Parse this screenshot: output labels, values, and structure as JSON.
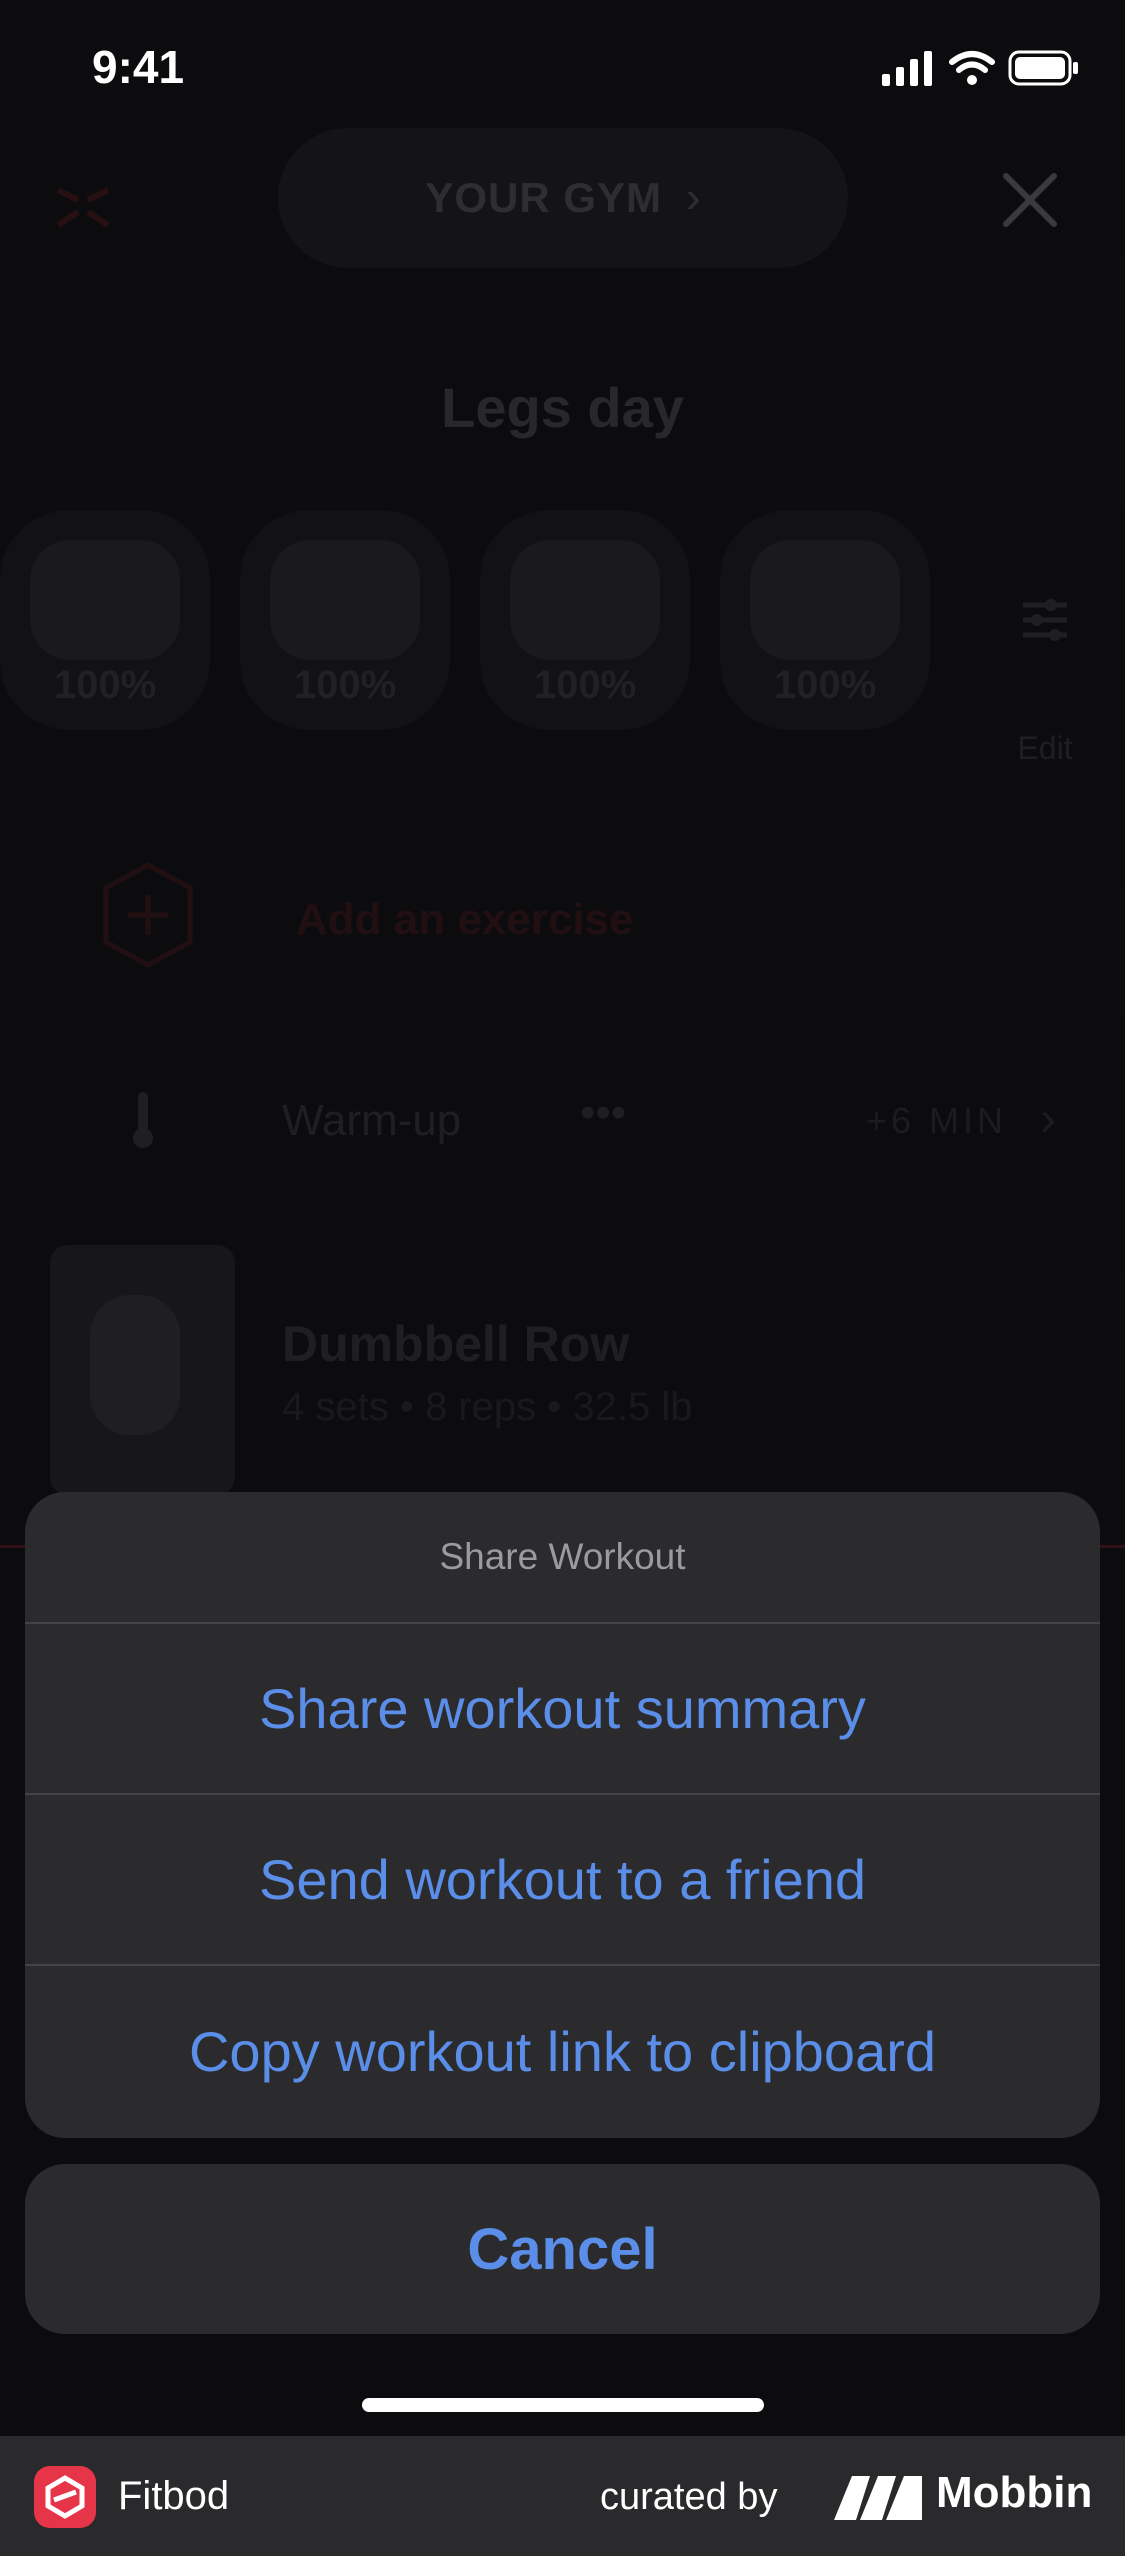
{
  "status_bar": {
    "time": "9:41"
  },
  "background": {
    "gym_label": "YOUR GYM",
    "workout_title": "Legs day",
    "muscles": [
      {
        "name": "muscle-group-1",
        "percent": "100%"
      },
      {
        "name": "muscle-group-2",
        "percent": "100%"
      },
      {
        "name": "muscle-group-3",
        "percent": "100%"
      },
      {
        "name": "muscle-group-4",
        "percent": "100%"
      }
    ],
    "edit_label": "Edit",
    "add_exercise_label": "Add an exercise",
    "warmup": {
      "label": "Warm-up",
      "dots": "•••",
      "duration": "+6 MIN"
    },
    "exercise": {
      "name": "Dumbbell Row",
      "meta": "4 sets • 8 reps • 32.5 lb"
    }
  },
  "action_sheet": {
    "title": "Share Workout",
    "items": [
      {
        "label": "Share workout summary"
      },
      {
        "label": "Send workout to a friend"
      },
      {
        "label": "Copy workout link to clipboard"
      }
    ],
    "cancel_label": "Cancel"
  },
  "footer": {
    "app_name": "Fitbod",
    "curated_by": "curated by",
    "brand": "Mobbin"
  },
  "colors": {
    "action_blue": "#5b8ee8",
    "sheet_bg": "#2b2b2e",
    "brand_red": "#e63548"
  }
}
